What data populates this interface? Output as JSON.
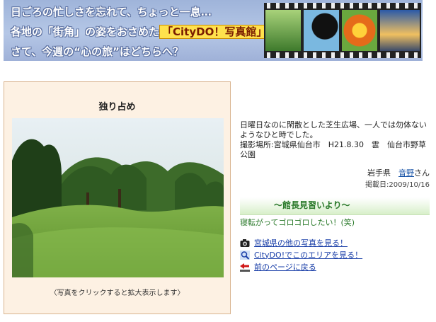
{
  "banner": {
    "line1": "日ごろの忙しさを忘れて、ちょっと一息…",
    "line2_prefix": "各地の「街角」の姿をおさめた",
    "line2_brand": "「CityDO！写真館」",
    "line2_suffix": "。",
    "line3": "さて、今週の“心の旅”はどちらへ？"
  },
  "photo": {
    "title": "独り占め",
    "caption": "〈写真をクリックすると拡大表示します〉"
  },
  "details": {
    "description": "日曜日なのに閑散とした芝生広場、一人では勿体ないようなひと時でした。",
    "location_line": "撮影場所:宮城県仙台市　H21.8.30　雲　仙台市野草公園",
    "author_pref": "岩手県",
    "author_name": "音野",
    "author_suffix": "さん",
    "post_date": "掲載日:2009/10/16"
  },
  "comment": {
    "header": "～館長見習いより～",
    "text": "寝転がってゴロゴロしたい！(笑)"
  },
  "links": {
    "other_photos": "宮城県の他の写真を見る！",
    "area": "CityDO!でこのエリアを見る！",
    "back": "前のページに戻る"
  },
  "icons": {
    "camera": "camera-icon",
    "magnifier": "magnifier-icon",
    "back": "back-arrow-icon"
  },
  "colors": {
    "banner_bg": "#a9bde1",
    "panel_bg": "#fdf1e3",
    "panel_border": "#d9b48f",
    "link": "#1a3fa8",
    "comment_green": "#2b7a2b"
  }
}
